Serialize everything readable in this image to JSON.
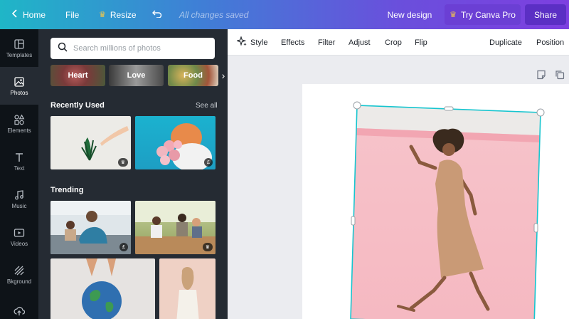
{
  "topbar": {
    "home_label": "Home",
    "file_label": "File",
    "resize_label": "Resize",
    "status_text": "All changes saved",
    "new_design_label": "New design",
    "try_pro_label": "Try Canva Pro",
    "share_label": "Share",
    "colors": {
      "pro_bg": "#6b3fd4",
      "share_bg": "#5b2fc4"
    }
  },
  "rail": {
    "items": [
      {
        "label": "Templates",
        "icon": "templates-icon"
      },
      {
        "label": "Photos",
        "icon": "photos-icon"
      },
      {
        "label": "Elements",
        "icon": "elements-icon"
      },
      {
        "label": "Text",
        "icon": "text-icon"
      },
      {
        "label": "Music",
        "icon": "music-icon"
      },
      {
        "label": "Videos",
        "icon": "videos-icon"
      },
      {
        "label": "Bkground",
        "icon": "background-icon"
      },
      {
        "label": "",
        "icon": "uploads-icon"
      }
    ],
    "active_index": 1
  },
  "panel": {
    "search_placeholder": "Search millions of photos",
    "chips": [
      {
        "label": "Heart",
        "color": "#8a4a4a"
      },
      {
        "label": "Love",
        "color": "#6f6f6f"
      },
      {
        "label": "Food",
        "color": "#7a6a4a"
      }
    ],
    "recently_used_title": "Recently Used",
    "see_all_label": "See all",
    "trending_title": "Trending",
    "badges": {
      "crown": "♛",
      "pound": "£"
    }
  },
  "toolbar": {
    "style_label": "Style",
    "effects_label": "Effects",
    "filter_label": "Filter",
    "adjust_label": "Adjust",
    "crop_label": "Crop",
    "flip_label": "Flip",
    "duplicate_label": "Duplicate",
    "position_label": "Position"
  }
}
